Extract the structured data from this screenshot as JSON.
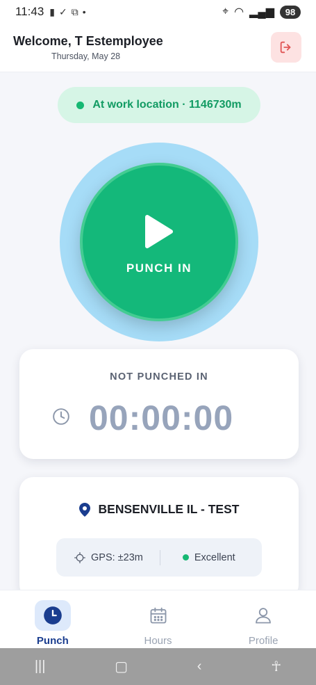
{
  "status_bar": {
    "time": "11:43",
    "battery": "98"
  },
  "header": {
    "welcome": "Welcome, T Estemployee",
    "date": "Thursday, May 28"
  },
  "location_status": {
    "text": "At work location · 1146730m",
    "color": "#16b873"
  },
  "punch": {
    "label": "PUNCH IN",
    "color": "#14b87a",
    "halo_color": "#a6dcf7"
  },
  "status_card": {
    "title": "NOT PUNCHED IN",
    "timer": "00:00:00"
  },
  "location_card": {
    "name": "BENSENVILLE IL - TEST",
    "gps_label": "GPS: ±23m",
    "quality": "Excellent"
  },
  "nav": {
    "items": [
      {
        "label": "Punch",
        "icon": "clock-icon",
        "active": true
      },
      {
        "label": "Hours",
        "icon": "calendar-icon",
        "active": false
      },
      {
        "label": "Profile",
        "icon": "person-icon",
        "active": false
      }
    ]
  }
}
